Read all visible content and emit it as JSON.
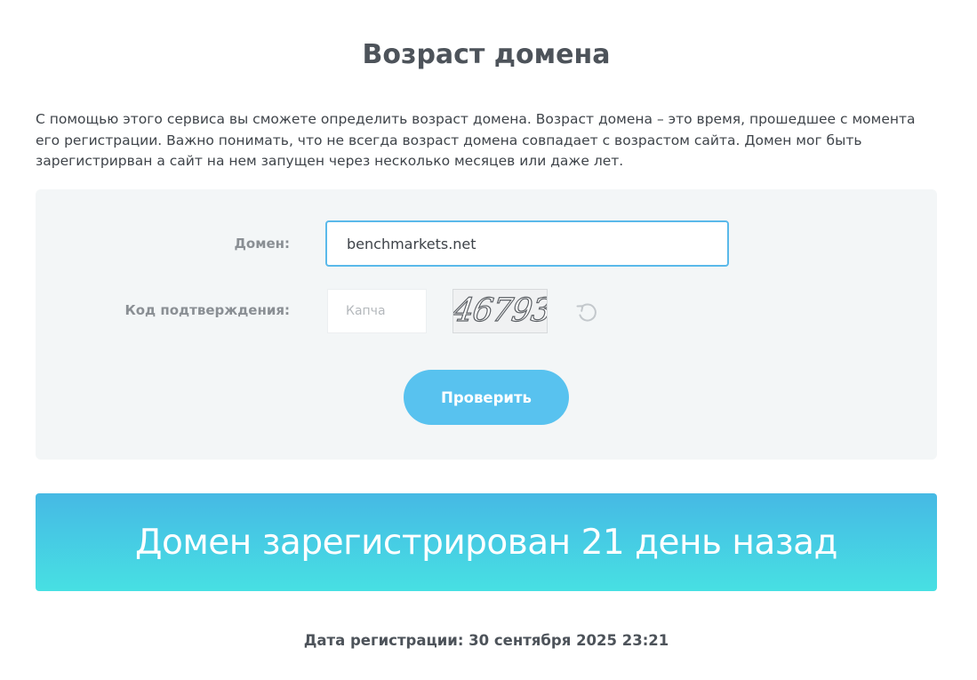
{
  "page": {
    "title": "Возраст домена",
    "description": "С помощью этого сервиса вы сможете определить возраст домена. Возраст домена – это время, прошедшее с момента его регистрации. Важно понимать, что не всегда возраст домена совпадает с возрастом сайта. Домен мог быть зарегистрирван а сайт на нем запущен через несколько месяцев или даже лет."
  },
  "form": {
    "domain_label": "Домен:",
    "domain_value": "benchmarkets.net",
    "code_label": "Код подтверждения:",
    "captcha_placeholder": "Капча",
    "captcha_value": "",
    "captcha_image_text": "46793",
    "refresh_icon": "refresh-icon",
    "submit_label": "Проверить"
  },
  "result": {
    "message": "Домен зарегистрирован 21 день назад",
    "registration_date": "Дата регистрации: 30 сентября 2025 23:21"
  },
  "colors": {
    "input_border_active": "#5ab9ea",
    "button_bg": "#58c2ef",
    "banner_gradient_top": "#46b9e4",
    "banner_gradient_bottom": "#47e0e3",
    "panel_bg": "#f3f6f7",
    "title_text": "#4d535a"
  }
}
